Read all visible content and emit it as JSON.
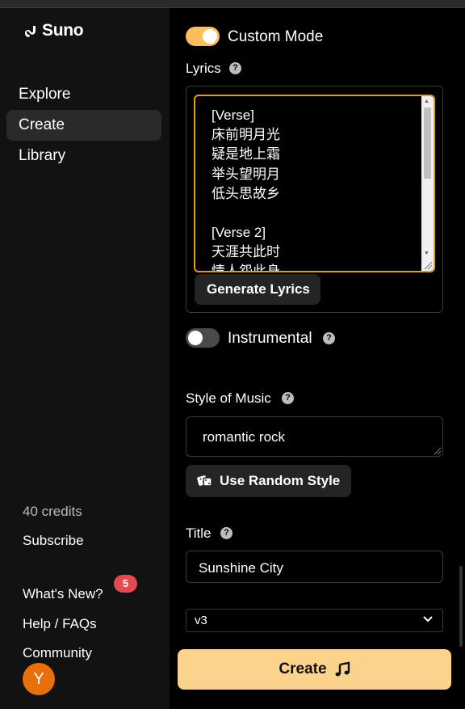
{
  "brand": {
    "name": "Suno"
  },
  "nav": [
    {
      "label": "Explore"
    },
    {
      "label": "Create"
    },
    {
      "label": "Library"
    }
  ],
  "sidebar_bottom": {
    "credits": "40 credits",
    "subscribe": "Subscribe",
    "whats_new": "What's New?",
    "whats_new_badge": "5",
    "help": "Help / FAQs",
    "community": "Community",
    "avatar_initial": "Y"
  },
  "form": {
    "custom_mode": {
      "label": "Custom Mode",
      "on": true
    },
    "lyrics": {
      "label": "Lyrics",
      "lines": [
        "[Verse]",
        "床前明月光",
        "疑是地上霜",
        "举头望明月",
        "低头思故乡",
        "",
        "[Verse 2]",
        "天涯共此时",
        "情人怨此身"
      ]
    },
    "generate_lyrics": "Generate Lyrics",
    "instrumental": {
      "label": "Instrumental",
      "on": false
    },
    "style": {
      "label": "Style of Music",
      "value": "romantic rock"
    },
    "random_style": "Use Random Style",
    "title": {
      "label": "Title",
      "value": "Sunshine City"
    },
    "model": {
      "selected": "v3"
    },
    "create": "Create"
  },
  "colors": {
    "accent": "#fbbf5a",
    "create_button": "#fbd38d",
    "focus_border": "#e89a1e",
    "badge": "#e5484d",
    "avatar": "#e8700c"
  },
  "icons": [
    "suno-logo-icon",
    "help-icon",
    "dice-icon",
    "music-note-icon",
    "chevron-down-icon"
  ]
}
